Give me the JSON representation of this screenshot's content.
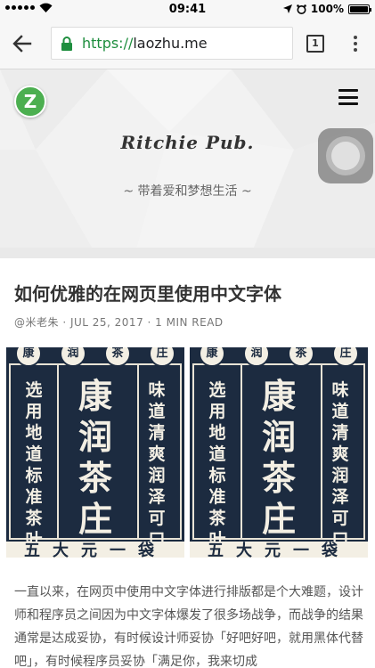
{
  "status_bar": {
    "time": "09:41",
    "battery": "100%",
    "battery_level": 1.0
  },
  "browser": {
    "url_scheme": "https://",
    "url_host": "laozhu.me",
    "tab_count": "1"
  },
  "header": {
    "logo_letter": "Z",
    "site_title": "Ritchie Pub.",
    "tagline": "~ 带着爱和梦想生活 ~"
  },
  "post": {
    "title": "如何优雅的在网页里使用中文字体",
    "meta": "@米老朱 · JUL 25, 2017 · 1 MIN READ",
    "body": "一直以来，在网页中使用中文字体进行排版都是个大难题，设计师和程序员之间因为中文字体爆发了很多场战争，而战争的结果通常是达成妥协，有时候设计师妥协「好吧好吧，就用黑体代替吧」，有时候程序员妥协「满足你，我来切成"
  },
  "image": {
    "circle_chars": [
      "康",
      "润",
      "茶",
      "庄"
    ],
    "left_column": "选用地道标准茶叶",
    "center_column": "康润茶庄",
    "right_column": "味道清爽润泽可口",
    "bottom_text": "五大元一袋",
    "colors": {
      "panel": "#1c2b40",
      "paper": "#f3efe4"
    }
  },
  "colors": {
    "url_green": "#1e8e3e",
    "logo_green": "#4caf50"
  }
}
